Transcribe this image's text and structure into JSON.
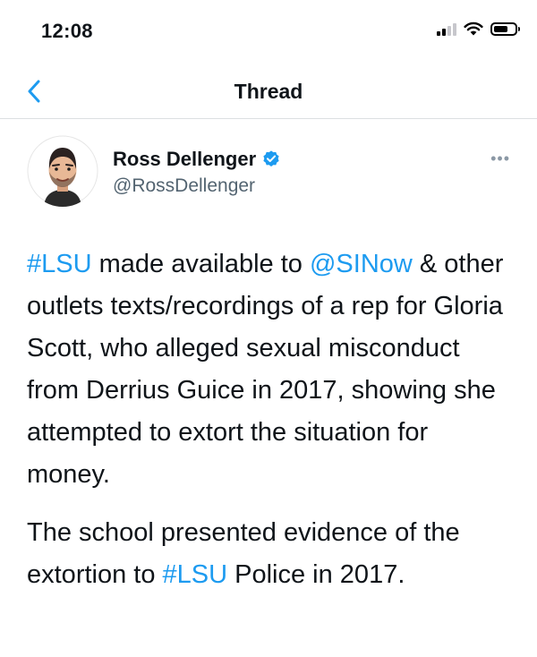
{
  "status_bar": {
    "time": "12:08",
    "signal_bars_filled": 2,
    "signal_bars_total": 4,
    "battery_fraction": 0.7
  },
  "nav": {
    "title": "Thread",
    "back_icon": "chevron-left-icon"
  },
  "author": {
    "name": "Ross Dellenger",
    "handle": "@RossDellenger",
    "verified": true
  },
  "more_icon_glyph": "•••",
  "tweet": {
    "p1": {
      "link1": "#LSU",
      "text1": " made available to ",
      "link2": "@SINow",
      "text2": " & other outlets texts/recordings of a rep for Gloria Scott, who alleged sexual misconduct from Derrius Guice in 2017, showing she attempted to extort the situation for money."
    },
    "p2": {
      "text1": "The school presented evidence of the extortion to ",
      "link1": "#LSU",
      "text2": " Police in 2017."
    }
  },
  "colors": {
    "accent": "#1d9bf0",
    "text": "#0f1419",
    "secondary": "#536471",
    "divider": "#dcdfe2"
  }
}
